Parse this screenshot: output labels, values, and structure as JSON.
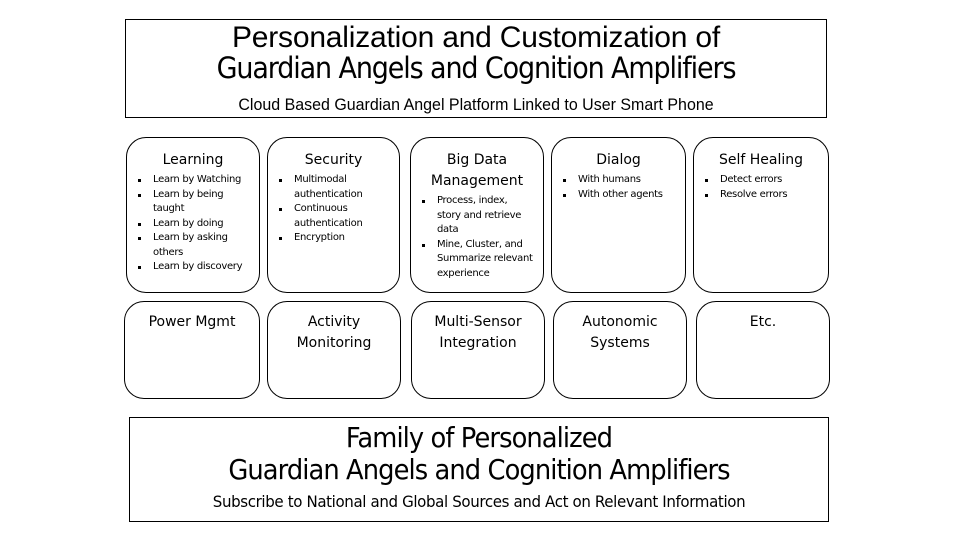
{
  "header": {
    "title_line1": "Personalization and Customization of",
    "title_line2": "Guardian Angels and Cognition Amplifiers",
    "subtitle": "Cloud Based Guardian Angel Platform Linked to User Smart Phone"
  },
  "row1": [
    {
      "title": "Learning",
      "bullets": [
        "Learn by Watching",
        "Learn by being taught",
        "Learn by doing",
        "Learn by asking others",
        "Learn by discovery"
      ]
    },
    {
      "title": "Security",
      "bullets": [
        "Multimodal authentication",
        "Continuous authentication",
        "Encryption"
      ]
    },
    {
      "title": "Big Data Management",
      "bullets": [
        "Process, index, story and retrieve data",
        "Mine, Cluster, and Summarize relevant experience"
      ]
    },
    {
      "title": "Dialog",
      "bullets": [
        "With humans",
        "With other agents"
      ]
    },
    {
      "title": "Self Healing",
      "bullets": [
        "Detect errors",
        "Resolve errors"
      ]
    }
  ],
  "row2": [
    {
      "title": "Power Mgmt"
    },
    {
      "title": "Activity Monitoring"
    },
    {
      "title": "Multi-Sensor Integration"
    },
    {
      "title": "Autonomic Systems"
    },
    {
      "title": "Etc."
    }
  ],
  "footer": {
    "title_line1": "Family of Personalized",
    "title_line2": "Guardian Angels and Cognition Amplifiers",
    "subtitle": "Subscribe to National and Global Sources and Act on Relevant Information"
  }
}
